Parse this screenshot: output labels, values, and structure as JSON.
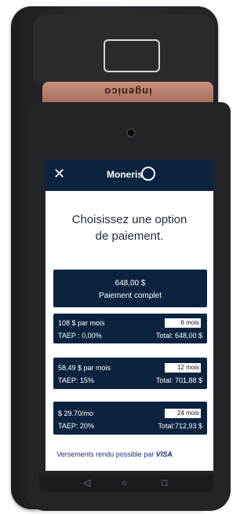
{
  "device": {
    "brand": "ingenico"
  },
  "screen": {
    "header": {
      "close_symbol": "✕",
      "logo_text": "Moneris"
    },
    "title_line1": "Choisissez une option",
    "title_line2": "de paiement.",
    "options": {
      "full": {
        "amount": "648,00 $",
        "label": "Paiement  complet"
      },
      "plans": [
        {
          "monthly": "108 $ par mois",
          "term": "6 mois",
          "apr": "TAEP : 0,00%",
          "total": "Total: 648,00 $"
        },
        {
          "monthly": "58,49 $ par mois",
          "term": "12 mois",
          "apr": "TAEP: 15%",
          "total": "Total: 701,88 $"
        },
        {
          "monthly": "$ 29.70/mo",
          "term": "24 mois",
          "apr": "TAEP: 20%",
          "total": "Total:712,93  $"
        }
      ]
    },
    "footer": {
      "text": "Versements rendu possible par",
      "visa": "VISA"
    }
  },
  "android_nav": {
    "back": "◁",
    "home": "○",
    "recent": "□"
  }
}
